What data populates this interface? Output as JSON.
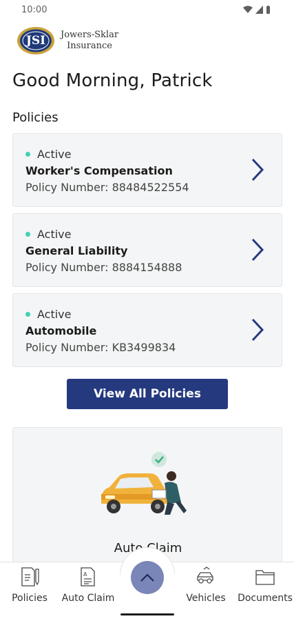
{
  "status_bar": {
    "time": "10:00"
  },
  "brand": {
    "logo_initials": "JSI",
    "name_line1": "Jowers-Sklar",
    "name_line2": "Insurance"
  },
  "greeting": "Good Morning, Patrick",
  "policies_section": {
    "title": "Policies",
    "items": [
      {
        "status": "Active",
        "name": "Worker's Compensation",
        "number": "Policy Number: 88484522554"
      },
      {
        "status": "Active",
        "name": "General Liability",
        "number": "Policy Number: 8884154888"
      },
      {
        "status": "Active",
        "name": "Automobile",
        "number": "Policy Number: KB3499834"
      }
    ],
    "view_all_label": "View All Policies"
  },
  "claim_card": {
    "label": "Auto Claim"
  },
  "bottom_nav": {
    "items": [
      {
        "label": "Policies",
        "icon": "policies-doc-icon"
      },
      {
        "label": "Auto Claim",
        "icon": "auto-claim-doc-icon"
      },
      {
        "label": "Vehicles",
        "icon": "car-icon"
      },
      {
        "label": "Documents",
        "icon": "folder-icon"
      }
    ],
    "fab_icon": "chevron-up-icon"
  },
  "colors": {
    "primary": "#25397f",
    "active_dot": "#3fd3b3",
    "fab": "#7a86b8",
    "card_bg": "#f4f5f6"
  }
}
